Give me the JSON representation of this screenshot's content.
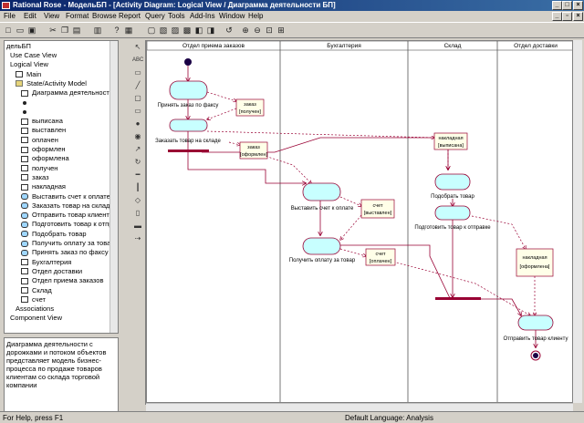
{
  "title": "Rational Rose - МодельБП - [Activity Diagram: Logical View / Диаграмма деятельности БП]",
  "menu": [
    "File",
    "Edit",
    "View",
    "Format",
    "Browse",
    "Report",
    "Query",
    "Tools",
    "Add-Ins",
    "Window",
    "Help"
  ],
  "tree": {
    "root": "дельБП",
    "items": [
      {
        "label": "Use Case View",
        "icon": "none"
      },
      {
        "label": "Logical View",
        "icon": "none"
      },
      {
        "label": "Main",
        "icon": "diag"
      },
      {
        "label": "State/Activity Model",
        "icon": "fold"
      },
      {
        "label": "Диаграмма деятельности Б",
        "icon": "diag"
      },
      {
        "label": "",
        "icon": "dot"
      },
      {
        "label": "",
        "icon": "dot"
      },
      {
        "label": "выписана",
        "icon": "obj"
      },
      {
        "label": "выставлен",
        "icon": "obj"
      },
      {
        "label": "оплачен",
        "icon": "obj"
      },
      {
        "label": "оформлен",
        "icon": "obj"
      },
      {
        "label": "оформлена",
        "icon": "obj"
      },
      {
        "label": "получен",
        "icon": "obj"
      },
      {
        "label": "заказ",
        "icon": "sw"
      },
      {
        "label": "накладная",
        "icon": "sw"
      },
      {
        "label": "Выставить счет к оплате",
        "icon": "st"
      },
      {
        "label": "Заказать товар на складе",
        "icon": "st"
      },
      {
        "label": "Отправить товар клиенту",
        "icon": "st"
      },
      {
        "label": "Подготовить товар к отправ",
        "icon": "st"
      },
      {
        "label": "Подобрать товар",
        "icon": "st"
      },
      {
        "label": "Получить оплату за товар",
        "icon": "st"
      },
      {
        "label": "Принять заказ по факсу",
        "icon": "st"
      },
      {
        "label": "Бухгалтерия",
        "icon": "sw"
      },
      {
        "label": "Отдел доставки",
        "icon": "sw"
      },
      {
        "label": "Отдел приема заказов",
        "icon": "sw"
      },
      {
        "label": "Склад",
        "icon": "sw"
      },
      {
        "label": "счет",
        "icon": "sw"
      },
      {
        "label": "Associations",
        "icon": "none"
      },
      {
        "label": "Component View",
        "icon": "none"
      }
    ]
  },
  "documentation": "Диаграмма деятельности с дорожками и потоком объектов представляет модель бизнес-процесса по продаже товаров клиентам со склада торговой компании",
  "swimlanes": [
    "Отдел приема заказов",
    "Бухгалтерия",
    "Склад",
    "Отдел доставки"
  ],
  "activities": {
    "a1": "Принять заказ по факсу",
    "a2": "Заказать товар на складе",
    "a3": "Выставить счет к оплате",
    "a4": "Получить оплату за товар",
    "a5": "Подобрать товар",
    "a6": "Подготовить товар к отправке",
    "a7": "Отправить товар клиенту"
  },
  "objects": {
    "o1": {
      "name": "заказ",
      "state": "[получен]"
    },
    "o2": {
      "name": "заказ",
      "state": "[оформлен]"
    },
    "o3": {
      "name": "накладная",
      "state": "[выписана]"
    },
    "o4": {
      "name": "счет",
      "state": "[выставлен]"
    },
    "o5": {
      "name": "счет",
      "state": "[оплачен]"
    },
    "o6": {
      "name": "накладная",
      "state": "[оформлена]"
    }
  },
  "status": {
    "help": "For Help, press F1",
    "language": "Default Language: Analysis"
  },
  "colors": {
    "activity_fill": "#c8ffff",
    "lines": "#990033",
    "object_fill": "#ffffe8",
    "title_blue": "#0a246a"
  }
}
